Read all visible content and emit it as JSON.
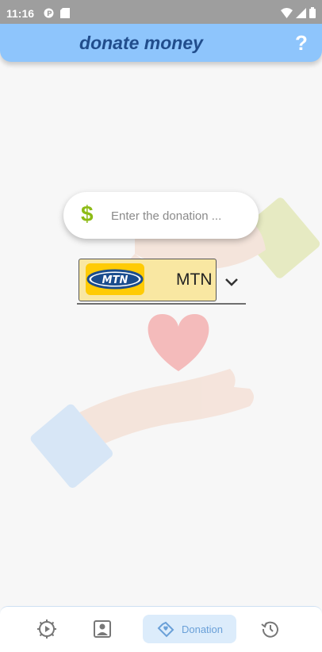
{
  "status_bar": {
    "time": "11:16"
  },
  "app_bar": {
    "title": "donate money",
    "help": "?"
  },
  "donation_form": {
    "amount_placeholder": "Enter the donation ...",
    "currency_symbol": "$",
    "provider": {
      "selected": "MTN",
      "logo_text": "MTN"
    }
  },
  "bottom_nav": {
    "items": [
      {
        "id": "tutorial",
        "icon": "gear-play-icon"
      },
      {
        "id": "profile",
        "icon": "profile-picture-icon"
      },
      {
        "id": "donation",
        "icon": "handshake-heart-icon",
        "label": "Donation",
        "active": true
      },
      {
        "id": "history",
        "icon": "history-icon"
      }
    ]
  },
  "colors": {
    "app_bar": "#8ec5fc",
    "title": "#214d8c",
    "currency": "#8dbb16",
    "provider_bg": "#f9e7a2",
    "nav_active": "#dcecfb"
  }
}
